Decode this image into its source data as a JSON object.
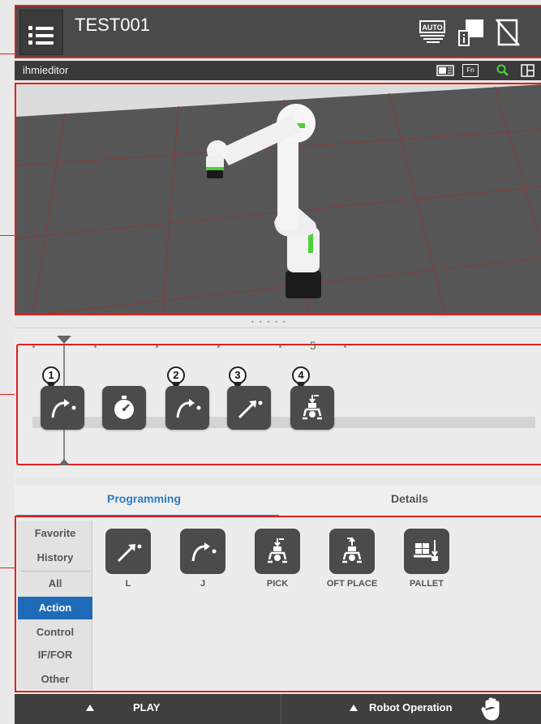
{
  "header": {
    "title": "TEST001",
    "mode_badge": "AUTO",
    "icons": [
      "menu-icon",
      "auto-mode-icon",
      "info-window-icon",
      "no-tablet-icon"
    ]
  },
  "subbar": {
    "title": "ihmieditor",
    "icons": [
      "display-toggle-icon",
      "fn-icon",
      "zoom-icon",
      "layout-icon"
    ],
    "fn_label": "Fn"
  },
  "timeline": {
    "ruler_label": "5",
    "nodes": [
      {
        "marker": "1",
        "icon": "joint-move-icon"
      },
      {
        "marker": "",
        "icon": "timer-icon"
      },
      {
        "marker": "2",
        "icon": "joint-move-icon"
      },
      {
        "marker": "3",
        "icon": "linear-move-icon"
      },
      {
        "marker": "4",
        "icon": "pick-icon"
      }
    ]
  },
  "tabs": {
    "programming": "Programming",
    "details": "Details"
  },
  "palette": {
    "categories": [
      "Favorite",
      "History",
      "All",
      "Action",
      "Control",
      "IF/FOR",
      "Other"
    ],
    "active_category": "Action",
    "items": [
      {
        "label": "L",
        "icon": "linear-move-icon"
      },
      {
        "label": "J",
        "icon": "joint-move-icon"
      },
      {
        "label": "PICK",
        "icon": "pick-icon"
      },
      {
        "label": "OFT PLACE",
        "icon": "offset-place-icon"
      },
      {
        "label": "PALLET",
        "icon": "pallet-icon"
      }
    ]
  },
  "bottombar": {
    "play": "PLAY",
    "robot_operation": "Robot Operation"
  },
  "colors": {
    "highlight_border": "#e0201f",
    "accent_blue": "#2a7bc2",
    "robot_green": "#4cd137"
  }
}
